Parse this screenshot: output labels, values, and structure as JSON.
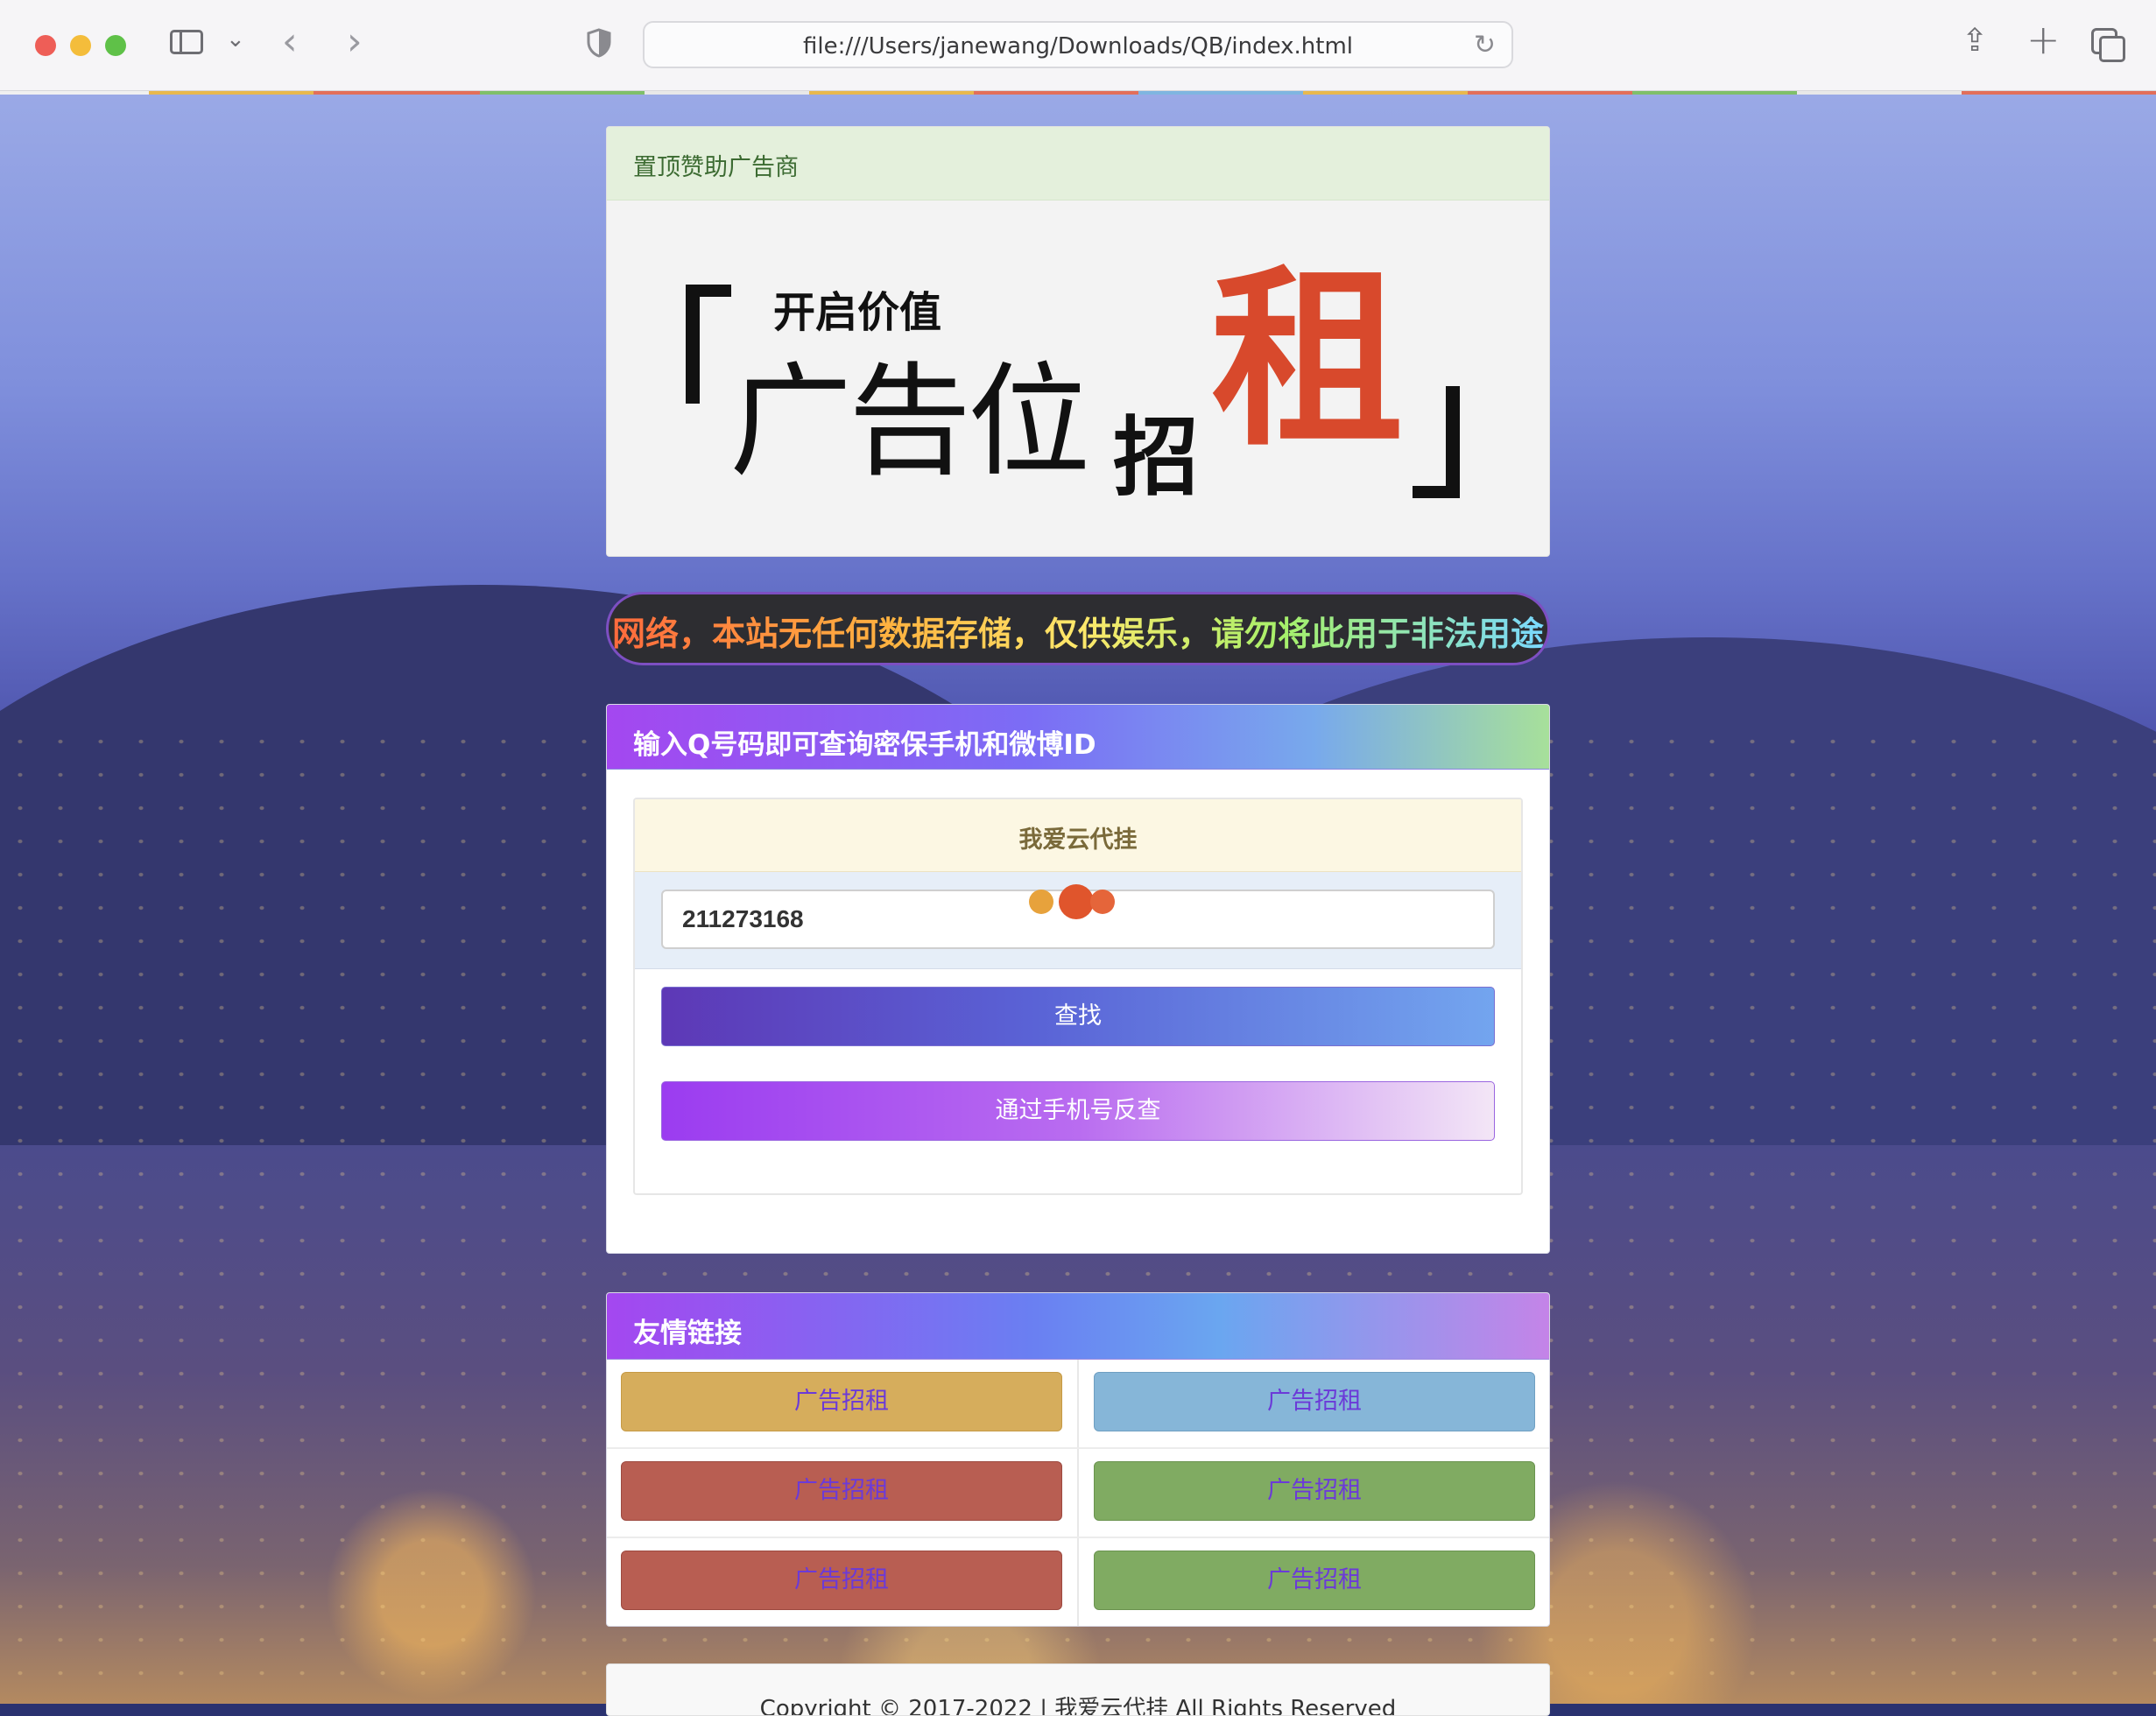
{
  "browser": {
    "url": "file:///Users/janewang/Downloads/QB/index.html"
  },
  "ad": {
    "header": "置顶赞助广告商",
    "banner_small": "开启价值",
    "banner_big": "广告位",
    "banner_mid": "招",
    "banner_red": "租"
  },
  "marquee": {
    "text": "网络，本站无任何数据存储，仅供娱乐，请勿将此用于非法用途"
  },
  "query": {
    "header": "输入Q号码即可查询密保手机和微博ID",
    "panel_title": "我爱云代挂",
    "qq_value": "211273168",
    "search_button": "查找",
    "phone_button": "通过手机号反查"
  },
  "links": {
    "header": "友情链接",
    "items": [
      {
        "label": "广告招租",
        "color": "#d6ad5c"
      },
      {
        "label": "广告招租",
        "color": "#86b6d8"
      },
      {
        "label": "广告招租",
        "color": "#b85e52"
      },
      {
        "label": "广告招租",
        "color": "#80ab62"
      },
      {
        "label": "广告招租",
        "color": "#b85e52"
      },
      {
        "label": "广告招租",
        "color": "#80ab62"
      }
    ]
  },
  "footer": {
    "text": "Copyright © 2017-2022 | 我爱云代挂 All Rights Reserved"
  },
  "colors": {
    "accent_purple": "#a447f0",
    "link_text": "#6b3ad8"
  }
}
